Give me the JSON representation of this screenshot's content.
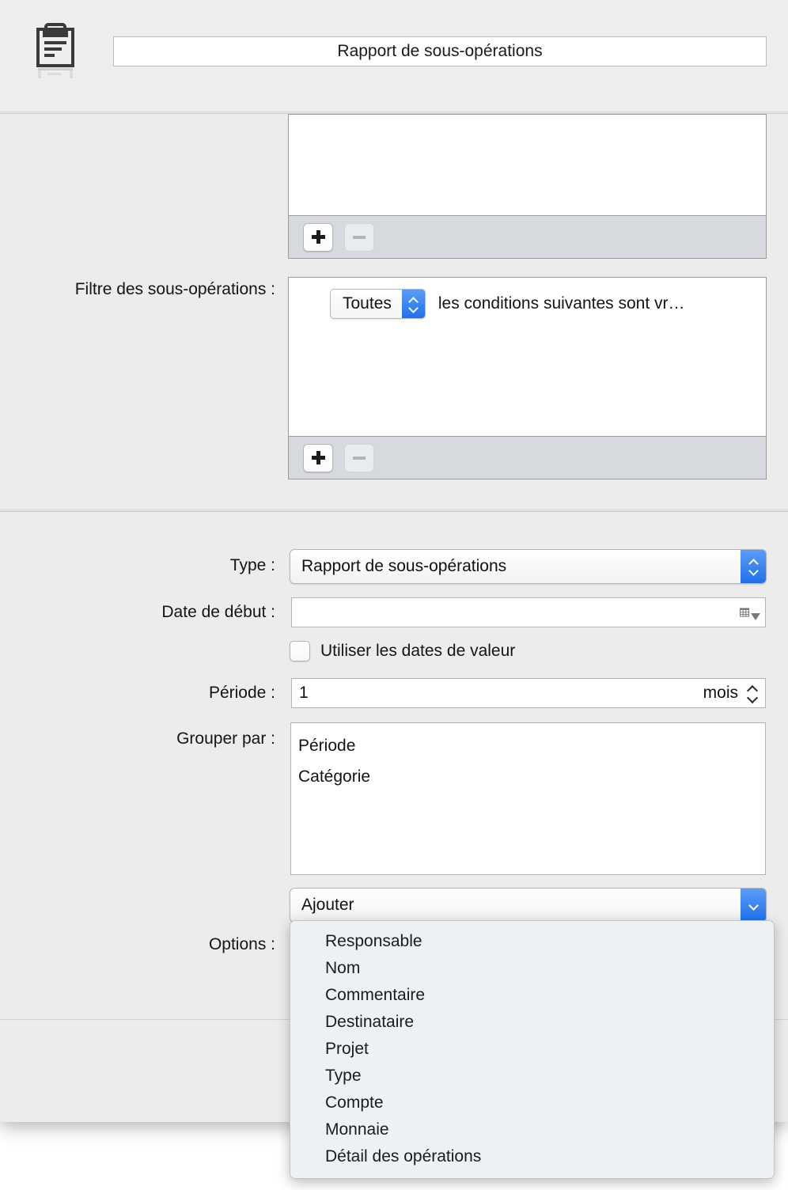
{
  "window": {
    "icon": "clipboard-icon",
    "title": "Rapport de sous-opérations"
  },
  "upper_section": {
    "top_list": {
      "add_button_label": "+",
      "remove_button_label": "−",
      "items": []
    },
    "filter": {
      "label": "Filtre des sous-opérations :",
      "match_popup_value": "Toutes",
      "condition_text": "les conditions suivantes sont vr…",
      "add_button_label": "+",
      "remove_button_label": "−"
    }
  },
  "form": {
    "type": {
      "label": "Type :",
      "value": "Rapport de sous-opérations"
    },
    "start_date": {
      "label": "Date de début :",
      "value": "",
      "calendar_icon": "calendar-icon"
    },
    "value_dates_checkbox": {
      "label": "Utiliser les dates de valeur",
      "checked": false
    },
    "period": {
      "label": "Période :",
      "value": "1",
      "unit": "mois"
    },
    "group_by": {
      "label": "Grouper par :",
      "items": [
        "Période",
        "Catégorie"
      ]
    },
    "add_popup": {
      "value": "Ajouter"
    },
    "options": {
      "label": "Options :"
    }
  },
  "open_menu": {
    "items": [
      "Responsable",
      "Nom",
      "Commentaire",
      "Destinataire",
      "Projet",
      "Type",
      "Compte",
      "Monnaie",
      "Détail des opérations"
    ]
  },
  "colors": {
    "accent_blue": "#1f70ec",
    "window_bg": "#ececec",
    "field_white": "#ffffff"
  }
}
